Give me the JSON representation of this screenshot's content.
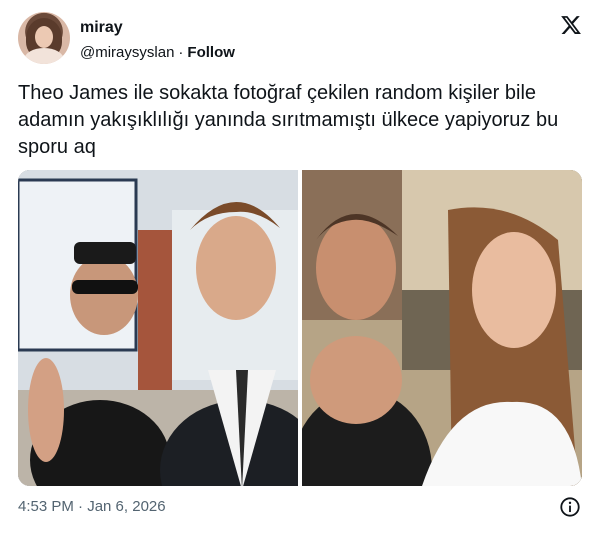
{
  "author": {
    "display_name": "miray",
    "handle": "@miraysyslan",
    "separator": "·",
    "follow_label": "Follow"
  },
  "tweet": {
    "text": "Theo James ile sokakta fotoğraf çekilen random kişiler bile adamın yakışıklılığı yanında sırıtmamıştı ülkece yapiyoruz bu sporu aq"
  },
  "media": {
    "count": 2,
    "images": [
      {
        "description_icon": "photo"
      },
      {
        "description_icon": "photo"
      }
    ]
  },
  "footer": {
    "timestamp": "4:53 PM · Jan 6, 2026"
  },
  "icons": {
    "brand": "x-logo-icon",
    "info": "info-icon"
  },
  "colors": {
    "text": "#0f1419",
    "secondary": "#536471"
  }
}
